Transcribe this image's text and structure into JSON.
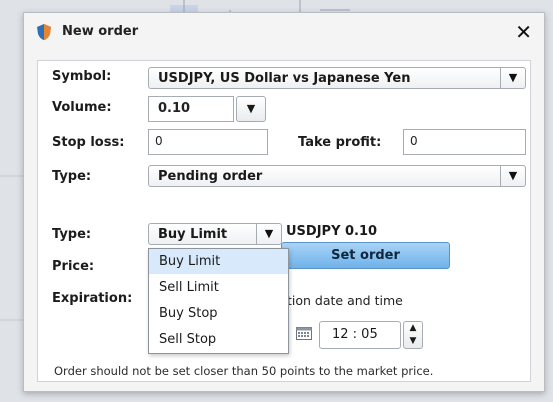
{
  "dialog": {
    "title": "New order",
    "close_label": "✕",
    "fields": {
      "symbol_label": "Symbol:",
      "symbol_value": "USDJPY, US Dollar vs Japanese Yen",
      "volume_label": "Volume:",
      "volume_value": "0.10",
      "stoploss_label": "Stop loss:",
      "stoploss_value": "0",
      "takeprofit_label": "Take profit:",
      "takeprofit_value": "0",
      "type_label": "Type:",
      "type_value": "Pending order",
      "pending_type_label": "Type:",
      "pending_type_value": "Buy Limit",
      "summary": "USDJPY  0.10",
      "price_label": "Price:",
      "set_order_label": "Set order",
      "expiration_label": "Expiration:",
      "expiration_text": "tion date and time",
      "time_value": "12 : 05",
      "note": "Order should not be set closer than 50 points to the market price."
    },
    "dropdown_options": [
      "Buy Limit",
      "Sell Limit",
      "Buy Stop",
      "Sell Stop"
    ],
    "dropdown_selected": "Buy Limit"
  },
  "colors": {
    "set_order_button": "#6eb2ea",
    "selected_option": "#d7e9fb",
    "icon_blue": "#2f6fb6",
    "icon_orange": "#e9862d"
  }
}
